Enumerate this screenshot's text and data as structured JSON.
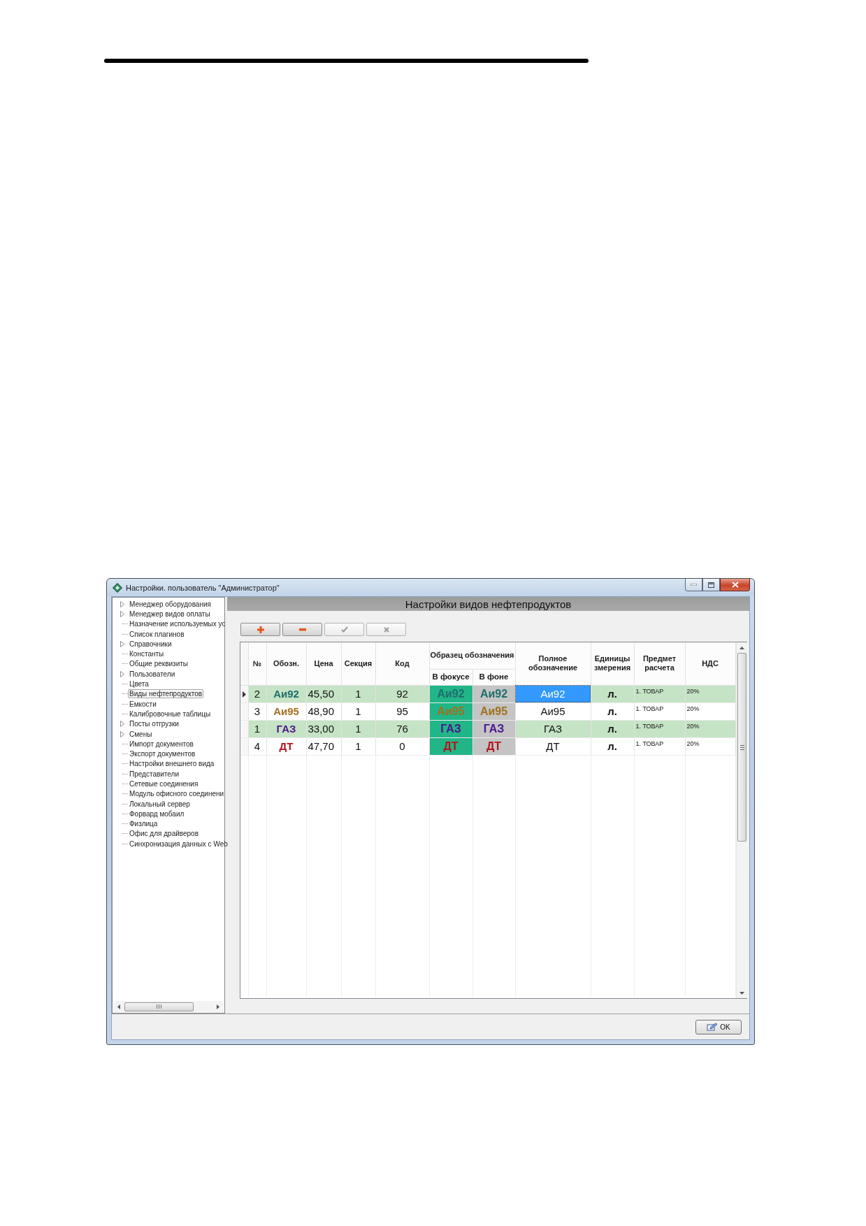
{
  "window": {
    "title": "Настройки. пользователь \"Администратор\""
  },
  "sidebar": {
    "items": [
      {
        "label": "Менеджер оборудования",
        "kind": "group",
        "selected": false
      },
      {
        "label": "Менеджер видов оплаты",
        "kind": "group",
        "selected": false
      },
      {
        "label": "Назначение используемых ус",
        "kind": "leaf",
        "selected": false
      },
      {
        "label": "Список плагинов",
        "kind": "leaf",
        "selected": false
      },
      {
        "label": "Справочники",
        "kind": "group",
        "selected": false
      },
      {
        "label": "Константы",
        "kind": "leaf",
        "selected": false
      },
      {
        "label": "Общие реквизиты",
        "kind": "leaf",
        "selected": false
      },
      {
        "label": "Пользователи",
        "kind": "group",
        "selected": false
      },
      {
        "label": "Цвета",
        "kind": "leaf",
        "selected": false
      },
      {
        "label": "Виды нефтепродуктов",
        "kind": "leaf",
        "selected": true
      },
      {
        "label": "Емкости",
        "kind": "leaf",
        "selected": false
      },
      {
        "label": "Калибровочные таблицы",
        "kind": "leaf",
        "selected": false
      },
      {
        "label": "Посты отгрузки",
        "kind": "group",
        "selected": false
      },
      {
        "label": "Смены",
        "kind": "group",
        "selected": false
      },
      {
        "label": "Импорт документов",
        "kind": "leaf",
        "selected": false
      },
      {
        "label": "Экспорт документов",
        "kind": "leaf",
        "selected": false
      },
      {
        "label": "Настройки внешнего вида",
        "kind": "leaf",
        "selected": false
      },
      {
        "label": "Представители",
        "kind": "leaf",
        "selected": false
      },
      {
        "label": "Сетевые соединения",
        "kind": "leaf",
        "selected": false
      },
      {
        "label": "Модуль офисного соединени",
        "kind": "leaf",
        "selected": false
      },
      {
        "label": "Локальный сервер",
        "kind": "leaf",
        "selected": false
      },
      {
        "label": "Форвард мобаил",
        "kind": "leaf",
        "selected": false
      },
      {
        "label": "Физлица",
        "kind": "leaf",
        "selected": false
      },
      {
        "label": "Офис для драйверов",
        "kind": "leaf",
        "selected": false
      },
      {
        "label": "Синхронизация данных с Web",
        "kind": "leaf",
        "selected": false
      }
    ]
  },
  "panel": {
    "title": "Настройки видов нефтепродуктов",
    "toolbar": [
      {
        "kind": "add",
        "disabled": false
      },
      {
        "kind": "delete",
        "disabled": false
      },
      {
        "kind": "apply",
        "disabled": true
      },
      {
        "kind": "cancel",
        "disabled": true
      }
    ],
    "table": {
      "columns": [
        {
          "label": "№"
        },
        {
          "label": "Обозн."
        },
        {
          "label": "Цена"
        },
        {
          "label": "Секция"
        },
        {
          "label": "Код"
        },
        {
          "label": "Образец обозначения",
          "subcolumns": [
            {
              "label": "В фокусе"
            },
            {
              "label": "В фоне"
            }
          ]
        },
        {
          "label": "Полное обозначение"
        },
        {
          "label": "Единицы змерения"
        },
        {
          "label": "Предмет расчета"
        },
        {
          "label": "НДС"
        }
      ],
      "rows": [
        {
          "number": "2",
          "short_name": "Аи92",
          "price": "45,50",
          "section": "1",
          "code": "92",
          "sample_focus": "Аи92",
          "sample_background": "Аи92",
          "full_name": "Аи92",
          "unit": "л.",
          "payment_subject": "1. ТОВАР",
          "vat": "20%",
          "color": "#1e6e6e",
          "selected": true
        },
        {
          "number": "3",
          "short_name": "Аи95",
          "price": "48,90",
          "section": "1",
          "code": "95",
          "sample_focus": "Аи95",
          "sample_background": "Аи95",
          "full_name": "Аи95",
          "unit": "л.",
          "payment_subject": "1. ТОВАР",
          "vat": "20%",
          "color": "#a0701c",
          "selected": false
        },
        {
          "number": "1",
          "short_name": "ГАЗ",
          "price": "33,00",
          "section": "1",
          "code": "76",
          "sample_focus": "ГАЗ",
          "sample_background": "ГАЗ",
          "full_name": "ГАЗ",
          "unit": "л.",
          "payment_subject": "1. ТОВАР",
          "vat": "20%",
          "color": "#4b1490",
          "selected": false
        },
        {
          "number": "4",
          "short_name": "ДТ",
          "price": "47,70",
          "section": "1",
          "code": "0",
          "sample_focus": "ДТ",
          "sample_background": "ДТ",
          "full_name": "ДТ",
          "unit": "л.",
          "payment_subject": "1. ТОВАР",
          "vat": "20%",
          "color": "#b3141c",
          "selected": false
        }
      ]
    }
  },
  "footer": {
    "ok_button": {
      "label": "OK"
    }
  }
}
